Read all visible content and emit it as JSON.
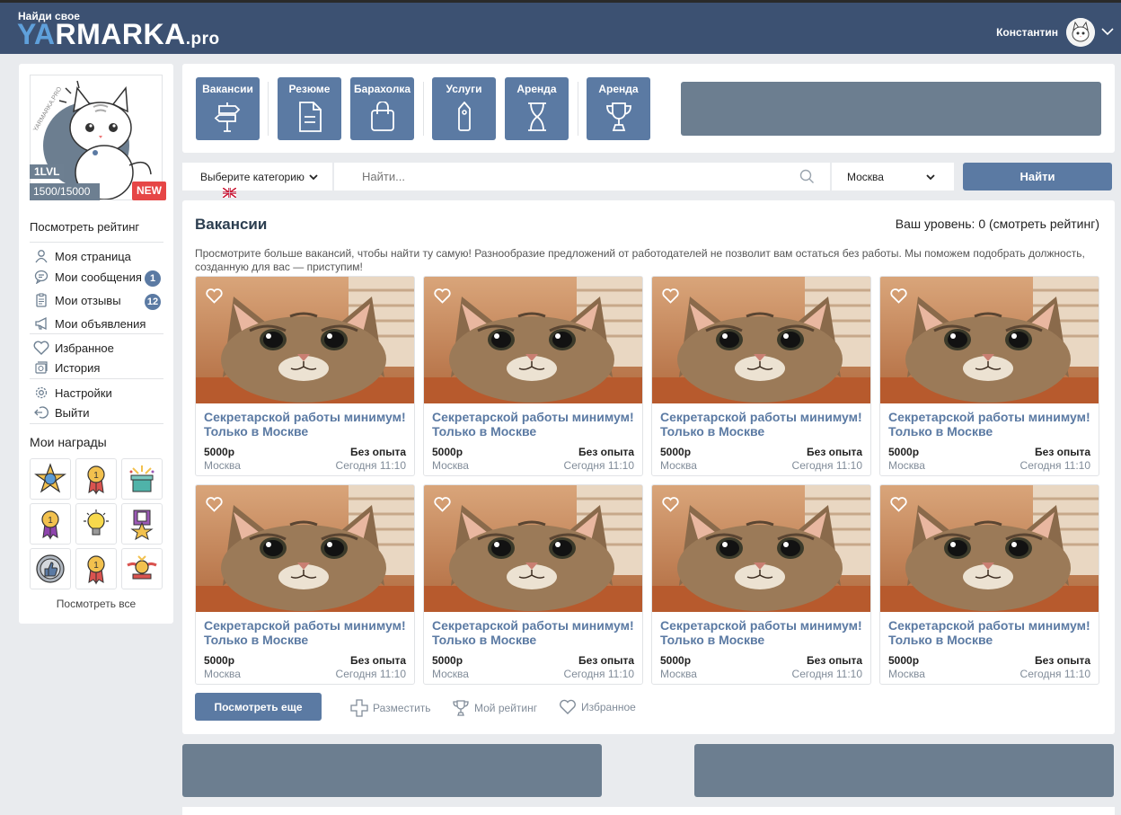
{
  "header": {
    "tagline": "Найди свое",
    "logo_ya": "YA",
    "logo_rest": "RMARKA",
    "logo_pro": ".pro",
    "user_name": "Константин"
  },
  "sidebar": {
    "level": "1LVL",
    "xp": "1500/15000",
    "new_badge": "NEW",
    "rating_link": "Посмотреть рейтинг",
    "menu": [
      {
        "label": "Моя страница",
        "icon": "user-icon"
      },
      {
        "label": "Мои сообщения",
        "icon": "messages-icon",
        "count": "1"
      },
      {
        "label": "Мои отзывы",
        "icon": "reviews-icon",
        "count": "12"
      },
      {
        "label": "Мои объявления",
        "icon": "megaphone-icon"
      },
      {
        "label": "Избранное",
        "icon": "heart-icon"
      },
      {
        "label": "История",
        "icon": "history-icon"
      },
      {
        "label": "Настройки",
        "icon": "gear-icon"
      },
      {
        "label": "Выйти",
        "icon": "logout-icon"
      }
    ],
    "awards_title": "Мои награды",
    "awards": [
      "star-medal-icon",
      "ribbon-medal-icon",
      "gift-icon",
      "medal-icon",
      "lightbulb-icon",
      "star-ribbon-icon",
      "thumbs-up-icon",
      "medal-icon",
      "winged-badge-icon"
    ],
    "see_all": "Посмотреть все"
  },
  "categories": [
    {
      "label": "Вакансии",
      "icon": "signpost-icon"
    },
    {
      "label": "Резюме",
      "icon": "document-icon"
    },
    {
      "label": "Барахолка",
      "icon": "bag-icon"
    },
    {
      "label": "Услуги",
      "icon": "tag-icon"
    },
    {
      "label": "Аренда",
      "icon": "hourglass-icon"
    },
    {
      "label": "Аренда",
      "icon": "trophy-icon"
    }
  ],
  "search": {
    "category": "Выберите категорию",
    "placeholder": "Найти...",
    "city": "Москва",
    "button": "Найти"
  },
  "vacancies": {
    "title": "Вакансии",
    "level_text": "Ваш уровень: 0 (смотреть рейтинг)",
    "description": "Просмотрите больше вакансий, чтобы найти ту самую! Разнообразие предложений от работодателей не позволит вам остаться без работы. Мы поможем подобрать должность, созданную для вас — приступим!",
    "items": [
      {
        "title": "Секретарской работы минимум! Только в Москве",
        "price": "5000р",
        "experience": "Без опыта",
        "city": "Москва",
        "date": "Сегодня 11:10"
      },
      {
        "title": "Секретарской работы минимум! Только в Москве",
        "price": "5000р",
        "experience": "Без опыта",
        "city": "Москва",
        "date": "Сегодня 11:10"
      },
      {
        "title": "Секретарской работы минимум! Только в Москве",
        "price": "5000р",
        "experience": "Без опыта",
        "city": "Москва",
        "date": "Сегодня 11:10"
      },
      {
        "title": "Секретарской работы минимум! Только в Москве",
        "price": "5000р",
        "experience": "Без опыта",
        "city": "Москва",
        "date": "Сегодня 11:10"
      },
      {
        "title": "Секретарской работы минимум! Только в Москве",
        "price": "5000р",
        "experience": "Без опыта",
        "city": "Москва",
        "date": "Сегодня 11:10"
      },
      {
        "title": "Секретарской работы минимум! Только в Москве",
        "price": "5000р",
        "experience": "Без опыта",
        "city": "Москва",
        "date": "Сегодня 11:10"
      },
      {
        "title": "Секретарской работы минимум! Только в Москве",
        "price": "5000р",
        "experience": "Без опыта",
        "city": "Москва",
        "date": "Сегодня 11:10"
      },
      {
        "title": "Секретарской работы минимум! Только в Москве",
        "price": "5000р",
        "experience": "Без опыта",
        "city": "Москва",
        "date": "Сегодня 11:10"
      }
    ],
    "more_button": "Посмотреть еще",
    "actions": [
      {
        "label": "Разместить",
        "icon": "plus-icon"
      },
      {
        "label": "Мой рейтинг",
        "icon": "trophy-icon"
      },
      {
        "label": "Избранное",
        "icon": "heart-icon"
      }
    ]
  },
  "colors": {
    "header_bg": "#3c5172",
    "accent": "#5b7aa3",
    "banner": "#6c7e90",
    "badge_red": "#e64646"
  }
}
